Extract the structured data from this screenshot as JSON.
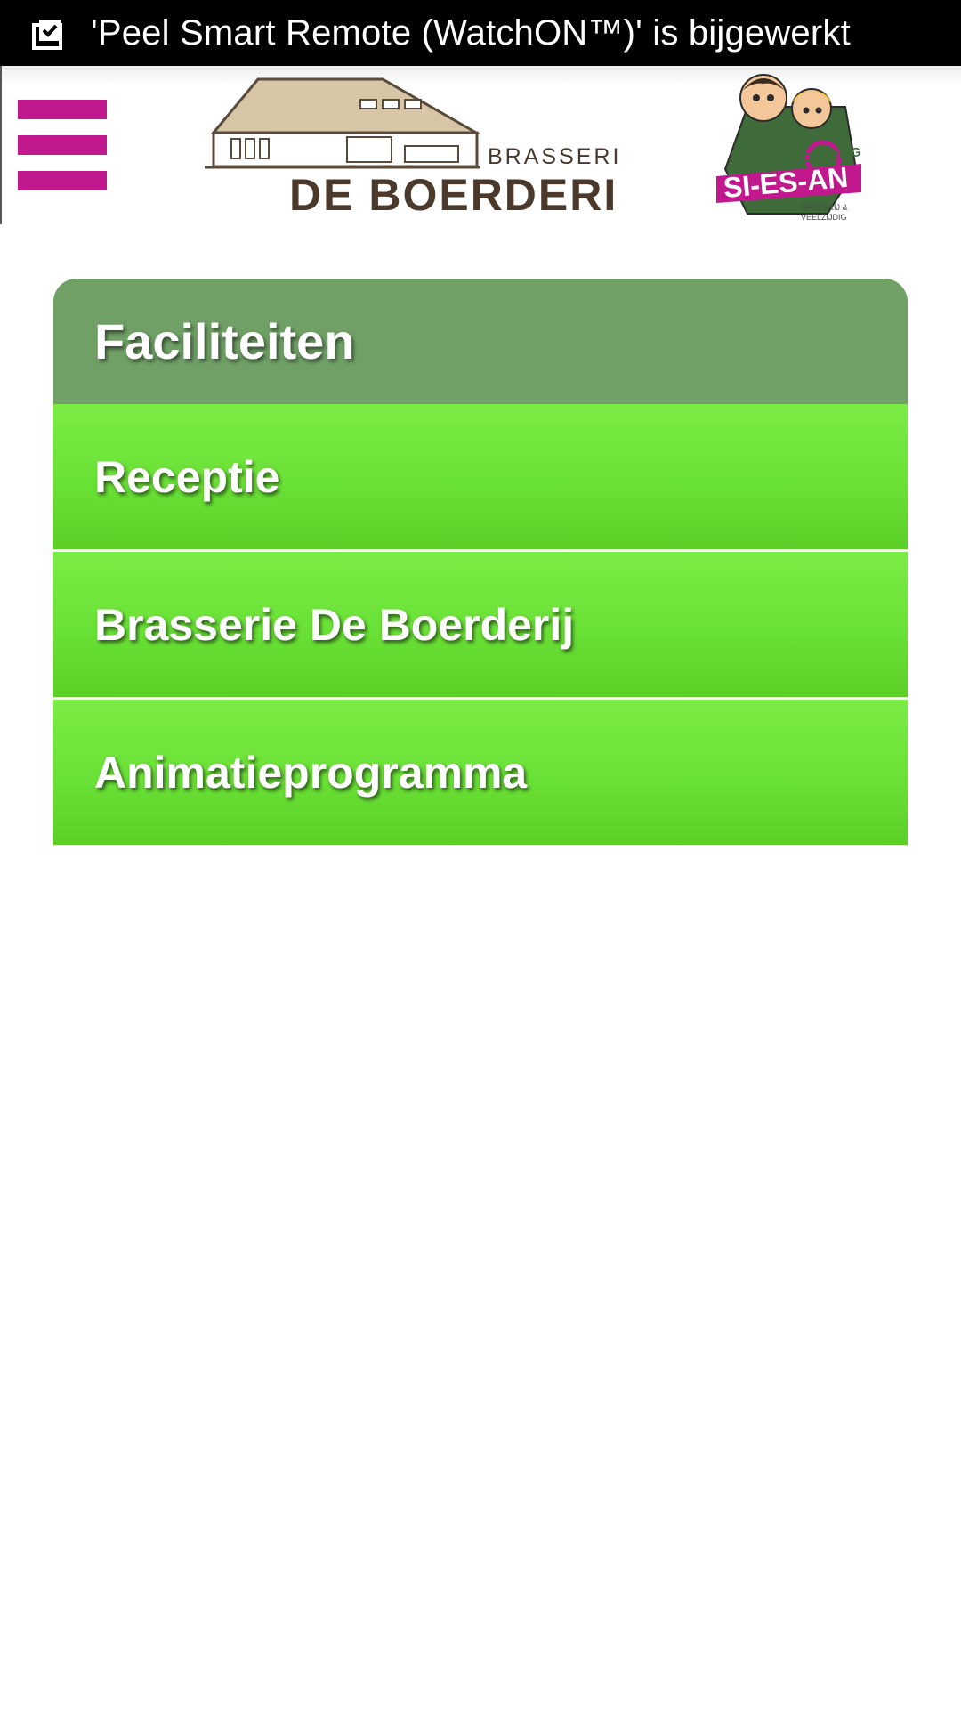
{
  "status_bar": {
    "notification_icon": "clipboard-check-icon",
    "notification_text": "'Peel Smart Remote (WatchON™)' is bijgewerkt"
  },
  "header": {
    "menu_icon": "hamburger-menu-icon",
    "menu_color": "#c2188d",
    "brand_logo": {
      "top_word": "BRASSERIE",
      "main_word": "DE BOERDERIJ"
    },
    "camping_logo": {
      "top_word": "CAMPING",
      "main_word": "SI-ES-AN",
      "tagline_line1": "GASTVRIJ &",
      "tagline_line2": "VEELZIJDIG"
    }
  },
  "panel": {
    "title": "Faciliteiten",
    "header_color": "#70a066",
    "item_color": "#6ae136",
    "items": [
      {
        "label": "Receptie"
      },
      {
        "label": "Brasserie De Boerderij"
      },
      {
        "label": "Animatieprogramma"
      }
    ]
  }
}
